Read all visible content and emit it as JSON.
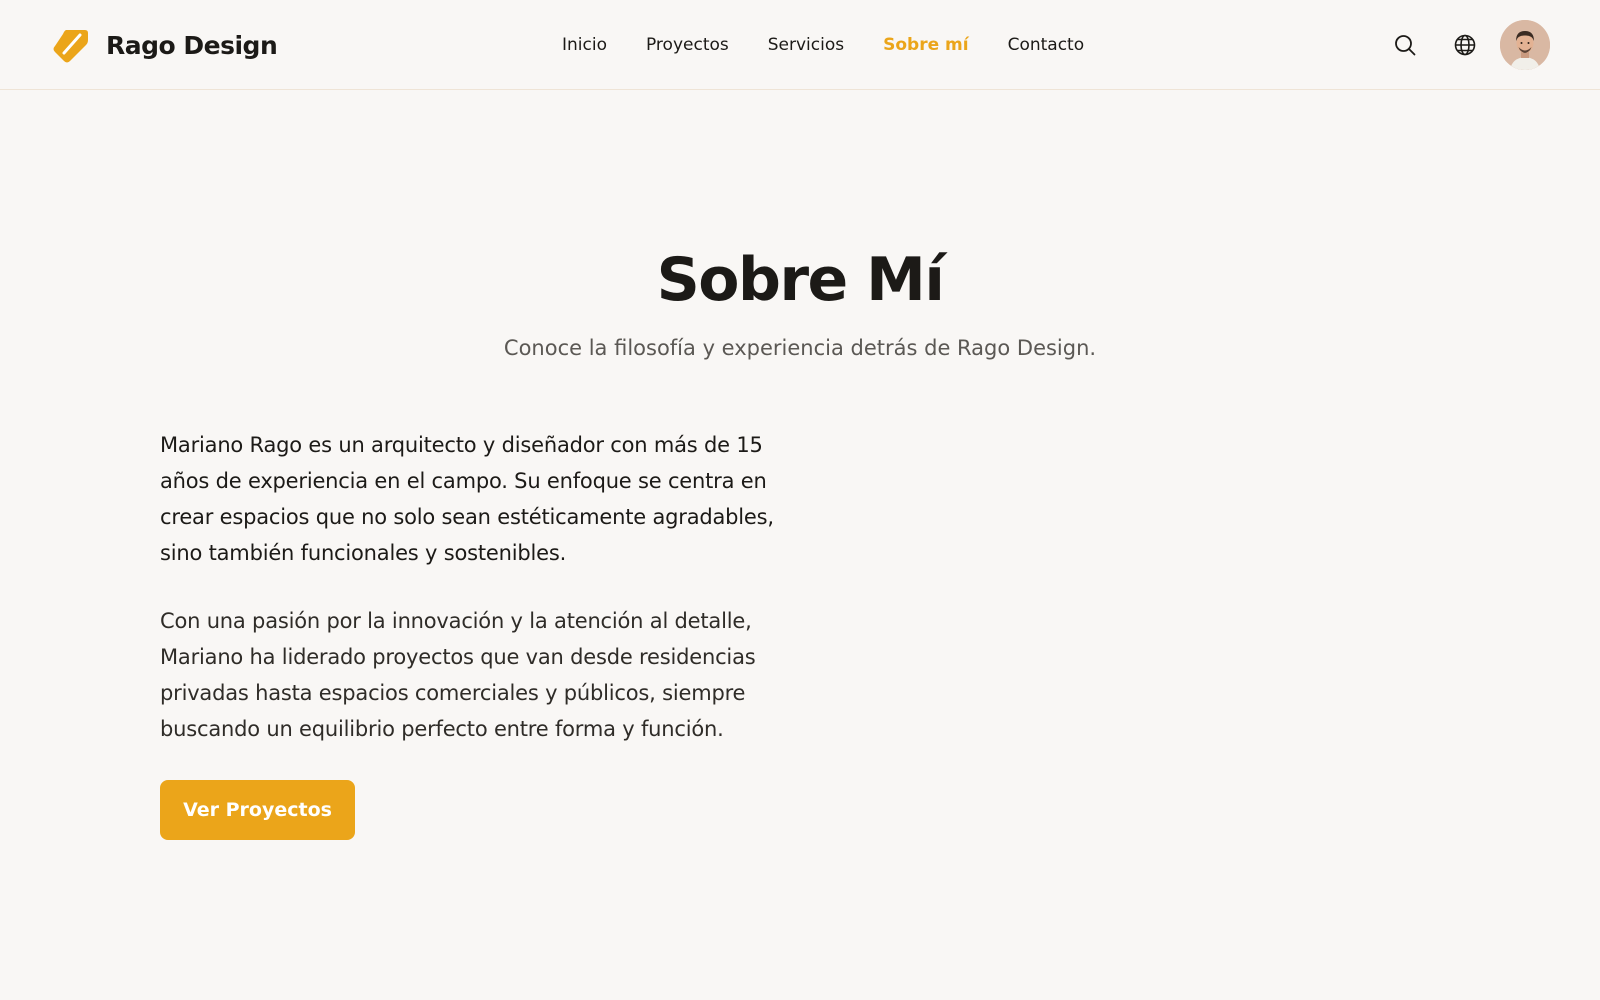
{
  "brand": {
    "name": "Rago Design",
    "accent_color": "#eba51a",
    "logo_icon": "tag-icon"
  },
  "nav": {
    "items": [
      {
        "label": "Inicio",
        "active": false
      },
      {
        "label": "Proyectos",
        "active": false
      },
      {
        "label": "Servicios",
        "active": false
      },
      {
        "label": "Sobre mí",
        "active": true
      },
      {
        "label": "Contacto",
        "active": false
      }
    ]
  },
  "header_actions": {
    "search_icon": "search-icon",
    "language_icon": "globe-icon",
    "avatar": "user-avatar"
  },
  "hero": {
    "title": "Sobre Mí",
    "subtitle": "Conoce la filosofía y experiencia detrás de Rago Design."
  },
  "bio": {
    "paragraph_1": "Mariano Rago es un arquitecto y diseñador con más de 15 años de experiencia en el campo. Su enfoque se centra en crear espacios que no solo sean estéticamente agradables, sino también funcionales y sostenibles.",
    "paragraph_2": "Con una pasión por la innovación y la atención al detalle, Mariano ha liderado proyectos que van desde residencias privadas hasta espacios comerciales y públicos, siempre buscando un equilibrio perfecto entre forma y función."
  },
  "cta": {
    "label": "Ver Proyectos"
  },
  "colors": {
    "background": "#f9f7f5",
    "text": "#1c1a17",
    "muted_text": "#5b5854",
    "accent": "#eba51a"
  }
}
